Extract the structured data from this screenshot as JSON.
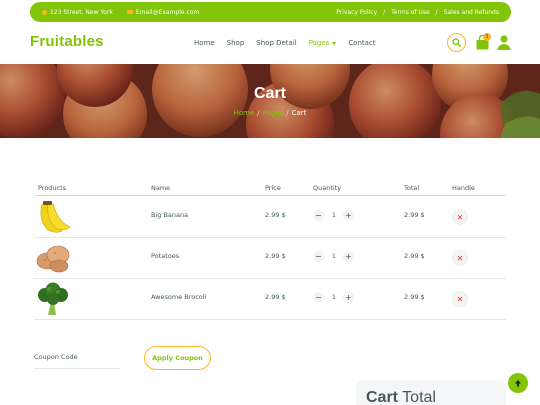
{
  "topbar": {
    "address": "123 Street, New York",
    "email": "Email@Example.com",
    "links": [
      "Privacy Policy",
      "Terms of Use",
      "Sales and Refunds"
    ],
    "separator": "/"
  },
  "brand": {
    "name": "Fruitables",
    "color": "#81c408",
    "accent": "#ffb524"
  },
  "nav": {
    "items": [
      "Home",
      "Shop",
      "Shop Detail",
      "Pages",
      "Contact"
    ],
    "active": "Pages",
    "cart_count": "3",
    "icons": [
      "search-icon",
      "shopping-bag-icon",
      "user-icon"
    ]
  },
  "hero": {
    "title": "Cart",
    "breadcrumb": [
      "Home",
      "Pages",
      "Cart"
    ],
    "breadcrumb_separator": "/"
  },
  "table": {
    "headers": [
      "Products",
      "Name",
      "Price",
      "Quantity",
      "Total",
      "Handle"
    ],
    "rows": [
      {
        "image": "banana",
        "name": "Big Banana",
        "price": "2.99 $",
        "quantity": "1",
        "total": "2.99 $"
      },
      {
        "image": "potatoes",
        "name": "Potatoes",
        "price": "2.99 $",
        "quantity": "1",
        "total": "2.99 $"
      },
      {
        "image": "broccoli",
        "name": "Awesome Brocoli",
        "price": "2.99 $",
        "quantity": "1",
        "total": "2.99 $"
      }
    ],
    "minus": "−",
    "plus": "+",
    "remove": "✕"
  },
  "coupon": {
    "placeholder": "Coupon Code",
    "button": "Apply Coupon"
  },
  "cart_total": {
    "title_bold": "Cart",
    "title_rest": "Total"
  }
}
